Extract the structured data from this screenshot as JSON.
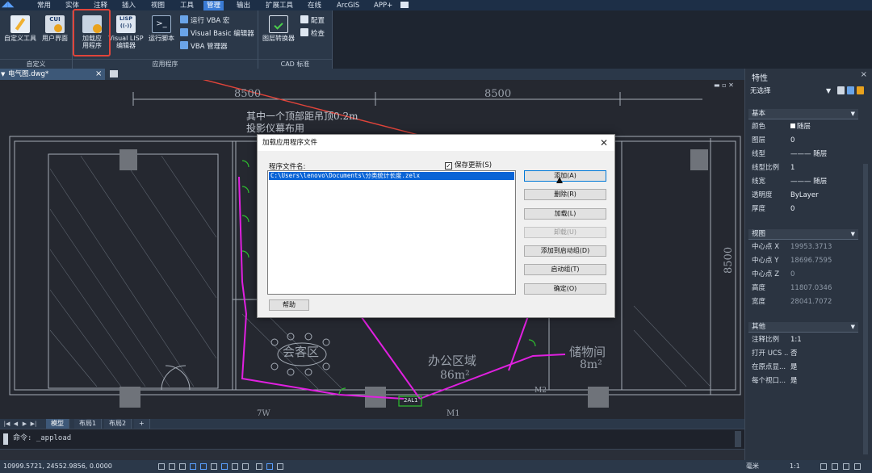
{
  "menu": {
    "items": [
      "常用",
      "实体",
      "注释",
      "插入",
      "视图",
      "工具",
      "管理",
      "输出",
      "扩展工具",
      "在线",
      "ArcGIS",
      "APP+"
    ],
    "active": "管理"
  },
  "ribbon": {
    "custom_group": {
      "label": "自定义",
      "buttons": [
        "自定义工具",
        "用户界面"
      ]
    },
    "app_group": {
      "label": "应用程序",
      "load_app": [
        "加载应",
        "用程序"
      ],
      "vlisp": [
        "Visual LISP",
        "编辑器"
      ],
      "run_script": "运行脚本",
      "run_vba": "运行 VBA 宏",
      "vb_editor": "Visual Basic 编辑器",
      "vba_manager": "VBA 管理器",
      "lisp_icon_text": "LISP",
      "cui_icon_text": "CUI"
    },
    "cad_group": {
      "label": "CAD 标准",
      "layer_converter": "图层转换器",
      "config": "配置",
      "check": "检查"
    }
  },
  "document": {
    "tab_title": "电气图.dwg*",
    "close": "×"
  },
  "drawing": {
    "dim_top_left": "8500",
    "dim_top_right": "8500",
    "dim_right": "8500",
    "note_line1": "其中一个顶部距吊顶0.2m",
    "note_line2": "投影仪幕布用",
    "room_meeting": "会客区",
    "room_office": "办公区域",
    "room_office_area": "86m²",
    "room_storage": "储物间",
    "room_storage_area": "8m²",
    "label_2al1": "2AL1",
    "label_m2": "M2",
    "label_7w": "7W",
    "label_m1": "M1"
  },
  "dialog": {
    "title": "加载应用程序文件",
    "close": "✕",
    "file_label": "程序文件名:",
    "save_updates": "保存更新(S)",
    "save_checked": "✓",
    "selected_file": "C:\\Users\\lenovo\\Documents\\分类统计长度.zelx",
    "buttons": {
      "add": "添加(A)",
      "remove": "删除(R)",
      "load": "加载(L)",
      "unload": "卸载(U)",
      "add_startup": "添加到启动组(D)",
      "startup": "启动组(T)",
      "ok": "确定(O)"
    },
    "help": "帮助"
  },
  "layout_tabs": [
    "模型",
    "布局1",
    "布局2",
    "+"
  ],
  "command": {
    "line": "命令: _appload"
  },
  "status": {
    "coords": "10999.5721, 24552.9856, 0.0000",
    "units": "毫米",
    "scale": "1:1"
  },
  "properties": {
    "title": "特性",
    "close": "×",
    "selection": "无选择",
    "sections": {
      "basic": {
        "label": "基本",
        "rows": [
          {
            "k": "颜色",
            "v": "随层"
          },
          {
            "k": "图层",
            "v": "0"
          },
          {
            "k": "线型",
            "v": "——— 随层"
          },
          {
            "k": "线型比例",
            "v": "1"
          },
          {
            "k": "线宽",
            "v": "——— 随层"
          },
          {
            "k": "透明度",
            "v": "ByLayer"
          },
          {
            "k": "厚度",
            "v": "0"
          }
        ]
      },
      "view": {
        "label": "视图",
        "rows": [
          {
            "k": "中心点 X",
            "v": "19953.3713"
          },
          {
            "k": "中心点 Y",
            "v": "18696.7595"
          },
          {
            "k": "中心点 Z",
            "v": "0"
          },
          {
            "k": "高度",
            "v": "11807.0346"
          },
          {
            "k": "宽度",
            "v": "28041.7072"
          }
        ]
      },
      "other": {
        "label": "其他",
        "rows": [
          {
            "k": "注释比例",
            "v": "1:1"
          },
          {
            "k": "打开 UCS ...",
            "v": "否"
          },
          {
            "k": "在原点显...",
            "v": "是"
          },
          {
            "k": "每个视口...",
            "v": "是"
          }
        ]
      }
    }
  },
  "colors": {
    "accent": "#3a7bd5",
    "highlight": "#e0443a",
    "selection": "#0a64d6",
    "magenta": "#e020e0",
    "green": "#2fc02f"
  }
}
